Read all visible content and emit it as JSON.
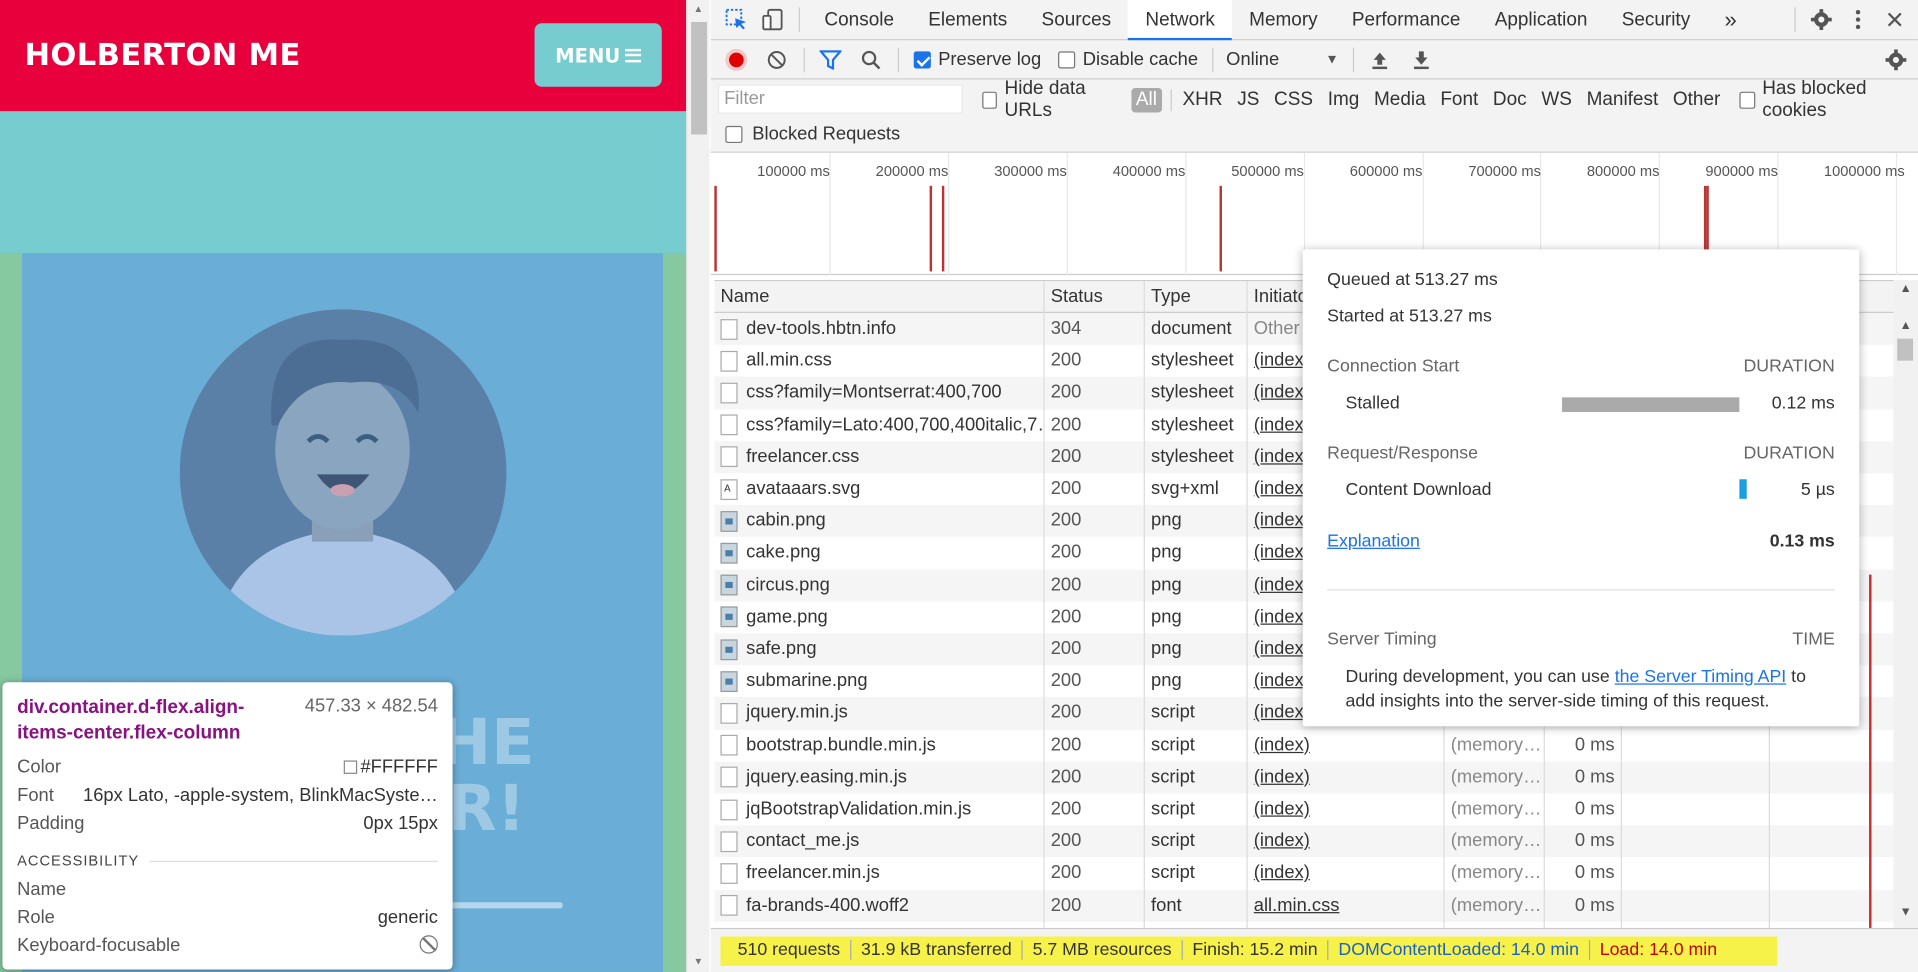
{
  "preview": {
    "brand": "HOLBERTON ME",
    "menu_label": "MENU",
    "hero_text_1": "HE",
    "hero_text_2": "R!"
  },
  "inspect_tooltip": {
    "selector": "div.container.d-flex.align-items-center.flex-column",
    "dimensions": "457.33 × 482.54",
    "color_label": "Color",
    "color_value": "#FFFFFF",
    "font_label": "Font",
    "font_value": "16px Lato, -apple-system, BlinkMacSyste…",
    "padding_label": "Padding",
    "padding_value": "0px 15px",
    "accessibility_heading": "ACCESSIBILITY",
    "name_label": "Name",
    "name_value": "",
    "role_label": "Role",
    "role_value": "generic",
    "focusable_label": "Keyboard-focusable"
  },
  "devtools": {
    "tabs": [
      "Console",
      "Elements",
      "Sources",
      "Network",
      "Memory",
      "Performance",
      "Application",
      "Security"
    ],
    "active_tab": "Network",
    "more_tabs": "»",
    "toolbar": {
      "preserve_log": "Preserve log",
      "disable_cache": "Disable cache",
      "throttle": "Online"
    },
    "filter": {
      "placeholder": "Filter",
      "hide_data_urls": "Hide data URLs",
      "all": "All",
      "types": [
        "XHR",
        "JS",
        "CSS",
        "Img",
        "Media",
        "Font",
        "Doc",
        "WS",
        "Manifest",
        "Other"
      ],
      "has_blocked_cookies": "Has blocked cookies",
      "blocked_requests": "Blocked Requests"
    },
    "overview_ticks": [
      "100000 ms",
      "200000 ms",
      "300000 ms",
      "400000 ms",
      "500000 ms",
      "600000 ms",
      "700000 ms",
      "800000 ms",
      "900000 ms",
      "1000000 ms"
    ],
    "columns": {
      "name": "Name",
      "status": "Status",
      "type": "Type",
      "initiator": "Initiator"
    },
    "requests": [
      {
        "name": "dev-tools.hbtn.info",
        "status": "304",
        "type": "document",
        "initiator": "Other",
        "size": "",
        "time": "",
        "icon": "doc"
      },
      {
        "name": "all.min.css",
        "status": "200",
        "type": "stylesheet",
        "initiator": "(index)",
        "size": "",
        "time": "",
        "icon": "doc"
      },
      {
        "name": "css?family=Montserrat:400,700",
        "status": "200",
        "type": "stylesheet",
        "initiator": "(index)",
        "size": "",
        "time": "",
        "icon": "doc"
      },
      {
        "name": "css?family=Lato:400,700,400italic,7…",
        "status": "200",
        "type": "stylesheet",
        "initiator": "(index)",
        "size": "",
        "time": "",
        "icon": "doc"
      },
      {
        "name": "freelancer.css",
        "status": "200",
        "type": "stylesheet",
        "initiator": "(index)",
        "size": "",
        "time": "",
        "icon": "doc"
      },
      {
        "name": "avataaars.svg",
        "status": "200",
        "type": "svg+xml",
        "initiator": "(index)",
        "size": "",
        "time": "",
        "icon": "svg"
      },
      {
        "name": "cabin.png",
        "status": "200",
        "type": "png",
        "initiator": "(index)",
        "size": "",
        "time": "",
        "icon": "img"
      },
      {
        "name": "cake.png",
        "status": "200",
        "type": "png",
        "initiator": "(index)",
        "size": "",
        "time": "",
        "icon": "img"
      },
      {
        "name": "circus.png",
        "status": "200",
        "type": "png",
        "initiator": "(index)",
        "size": "",
        "time": "",
        "icon": "img"
      },
      {
        "name": "game.png",
        "status": "200",
        "type": "png",
        "initiator": "(index)",
        "size": "",
        "time": "",
        "icon": "img"
      },
      {
        "name": "safe.png",
        "status": "200",
        "type": "png",
        "initiator": "(index)",
        "size": "",
        "time": "",
        "icon": "img"
      },
      {
        "name": "submarine.png",
        "status": "200",
        "type": "png",
        "initiator": "(index)",
        "size": "",
        "time": "",
        "icon": "img"
      },
      {
        "name": "jquery.min.js",
        "status": "200",
        "type": "script",
        "initiator": "(index)",
        "size": "",
        "time": "",
        "icon": "doc"
      },
      {
        "name": "bootstrap.bundle.min.js",
        "status": "200",
        "type": "script",
        "initiator": "(index)",
        "size": "(memory…",
        "time": "0 ms",
        "icon": "doc"
      },
      {
        "name": "jquery.easing.min.js",
        "status": "200",
        "type": "script",
        "initiator": "(index)",
        "size": "(memory…",
        "time": "0 ms",
        "icon": "doc"
      },
      {
        "name": "jqBootstrapValidation.min.js",
        "status": "200",
        "type": "script",
        "initiator": "(index)",
        "size": "(memory…",
        "time": "0 ms",
        "icon": "doc"
      },
      {
        "name": "contact_me.js",
        "status": "200",
        "type": "script",
        "initiator": "(index)",
        "size": "(memory…",
        "time": "0 ms",
        "icon": "doc"
      },
      {
        "name": "freelancer.min.js",
        "status": "200",
        "type": "script",
        "initiator": "(index)",
        "size": "(memory…",
        "time": "0 ms",
        "icon": "doc"
      },
      {
        "name": "fa-brands-400.woff2",
        "status": "200",
        "type": "font",
        "initiator": "all.min.css",
        "size": "(memory…",
        "time": "0 ms",
        "icon": "doc"
      }
    ],
    "status_bar": {
      "requests": "510 requests",
      "transferred": "31.9 kB transferred",
      "resources": "5.7 MB resources",
      "finish": "Finish: 15.2 min",
      "dcl": "DOMContentLoaded: 14.0 min",
      "load": "Load: 14.0 min"
    },
    "timing_popover": {
      "queued": "Queued at 513.27 ms",
      "started": "Started at 513.27 ms",
      "connection_start": "Connection Start",
      "duration_label": "DURATION",
      "stalled": "Stalled",
      "stalled_value": "0.12 ms",
      "request_response": "Request/Response",
      "content_download": "Content Download",
      "content_download_value": "5 µs",
      "explanation": "Explanation",
      "total": "0.13 ms",
      "server_timing": "Server Timing",
      "time_label": "TIME",
      "server_text_1": "During development, you can use ",
      "server_link": "the Server Timing API",
      "server_text_2": " to add insights into the server-side timing of this request."
    },
    "colors": {
      "accent": "#1a73e8",
      "record": "#e00000",
      "waterfall": "#1a9fe0",
      "stalled_bar": "#aaaaaa",
      "highlight": "#f7f24a",
      "dcl": "#1a60c8",
      "load": "#c80000"
    }
  }
}
